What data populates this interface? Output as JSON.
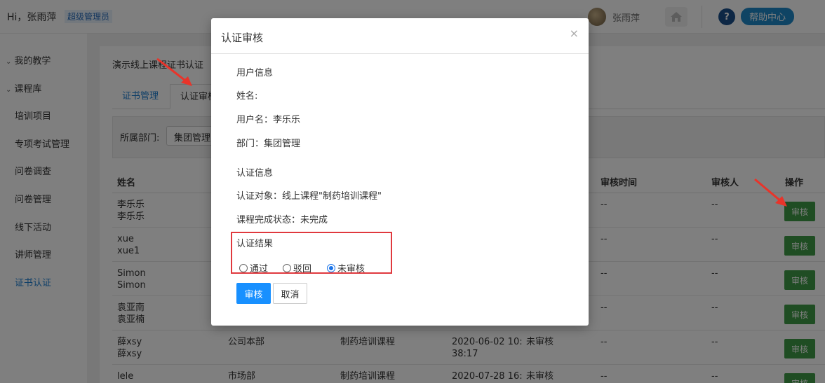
{
  "header": {
    "greeting": "Hi，张雨萍",
    "role": "超级管理员",
    "user_name": "张雨萍",
    "help_label": "帮助中心"
  },
  "sidebar": {
    "groups": [
      {
        "label": "我的教学"
      },
      {
        "label": "课程库"
      }
    ],
    "items": [
      {
        "label": "培训项目"
      },
      {
        "label": "专项考试管理"
      },
      {
        "label": "问卷调查"
      },
      {
        "label": "问卷管理"
      },
      {
        "label": "线下活动"
      },
      {
        "label": "讲师管理"
      },
      {
        "label": "证书认证"
      }
    ]
  },
  "main": {
    "breadcrumb": "演示线上课程证书认证",
    "tabs": [
      {
        "label": "证书管理"
      },
      {
        "label": "认证审核"
      }
    ],
    "filter": {
      "label": "所属部门:",
      "value": "集团管理"
    },
    "table": {
      "headers": {
        "name": "姓名",
        "review_time": "审核时间",
        "reviewer": "审核人",
        "action": "操作"
      },
      "rows": [
        {
          "name1": "李乐乐",
          "name2": "李乐乐",
          "dept": "",
          "course": "",
          "date1": "",
          "date2": "",
          "status": "",
          "review_time": "--",
          "reviewer": "--",
          "action": "审核"
        },
        {
          "name1": "xue",
          "name2": "xue1",
          "dept": "",
          "course": "",
          "date1": "",
          "date2": "",
          "status": "",
          "review_time": "--",
          "reviewer": "--",
          "action": "审核"
        },
        {
          "name1": "Simon",
          "name2": "Simon",
          "dept": "",
          "course": "",
          "date1": "",
          "date2": "",
          "status": "",
          "review_time": "--",
          "reviewer": "--",
          "action": "审核"
        },
        {
          "name1": "袁亚南",
          "name2": "袁亚楠",
          "dept": "",
          "course": "",
          "date1": "",
          "date2": "",
          "status": "",
          "review_time": "--",
          "reviewer": "--",
          "action": "审核"
        },
        {
          "name1": "薛xsy",
          "name2": "薛xsy",
          "dept": "公司本部",
          "course": "制药培训课程",
          "date1": "2020-06-02 10:",
          "date2": "38:17",
          "status": "未审核",
          "review_time": "--",
          "reviewer": "--",
          "action": "审核"
        },
        {
          "name1": "lele",
          "name2": "",
          "dept": "市场部",
          "course": "制药培训课程",
          "date1": "2020-07-28 16:",
          "date2": "",
          "status": "未审核",
          "review_time": "--",
          "reviewer": "--",
          "action": "审核"
        }
      ]
    }
  },
  "modal": {
    "title": "认证审核",
    "close": "×",
    "user_info_heading": "用户信息",
    "name_line": "姓名:",
    "username_line": "用户名：李乐乐",
    "dept_line": "部门：集团管理",
    "cert_info_heading": "认证信息",
    "target_line": "认证对象：线上课程\"制药培训课程\"",
    "completion_line": "课程完成状态：未完成",
    "result_heading": "认证结果",
    "options": [
      {
        "label": "通过",
        "selected": false
      },
      {
        "label": "驳回",
        "selected": false
      },
      {
        "label": "未审核",
        "selected": true
      }
    ],
    "submit_label": "审核",
    "cancel_label": "取消"
  },
  "colors": {
    "accent": "#1890ff",
    "review_button": "#3f9b47",
    "highlight_border": "#e0393e"
  }
}
